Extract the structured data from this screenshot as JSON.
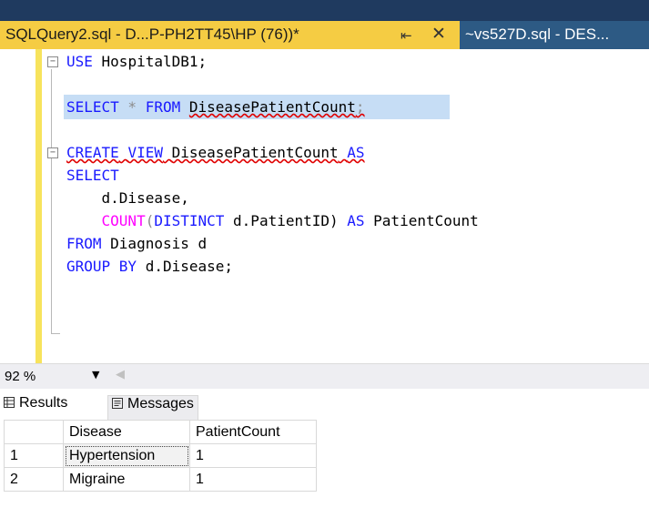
{
  "tabs": {
    "active": {
      "title": "SQLQuery2.sql - D...P-PH2TT45\\HP (76))*",
      "pin_icon": "pin-icon",
      "close_icon": "close-icon"
    },
    "inactive": {
      "title": "~vs527D.sql - DES..."
    }
  },
  "editor": {
    "line1": {
      "kw": "USE",
      "rest": " HospitalDB1;"
    },
    "line3": {
      "kw1": "SELECT",
      "star": " * ",
      "kw2": "FROM",
      "obj": "DiseasePatientCount",
      "semi": ";"
    },
    "line5": {
      "kw1": "CREATE",
      "kw2": "VIEW",
      "obj": "DiseasePatientCount",
      "kw3": "AS"
    },
    "line6": {
      "kw": "SELECT"
    },
    "line7": {
      "text": "    d.Disease,"
    },
    "line8": {
      "indent": "    ",
      "fn": "COUNT",
      "paren": "(",
      "kw": "DISTINCT",
      "col": " d.PatientID) ",
      "kw2": "AS",
      "alias": " PatientCount"
    },
    "line9": {
      "kw": "FROM",
      "rest": " Diagnosis d"
    },
    "line10": {
      "kw": "GROUP BY",
      "rest": " d.Disease;"
    }
  },
  "zoom": {
    "value": "92 %"
  },
  "results_tabs": {
    "results": "Results",
    "messages": "Messages"
  },
  "grid": {
    "columns": [
      "Disease",
      "PatientCount"
    ],
    "rows": [
      {
        "num": "1",
        "disease": "Hypertension",
        "count": "1"
      },
      {
        "num": "2",
        "disease": "Migraine",
        "count": "1"
      }
    ]
  },
  "colors": {
    "active_tab": "#f5cc43",
    "tab_strip": "#1f3a5f",
    "keyword": "#1a1aff",
    "function": "#ff00ff",
    "selection": "#c6ddf5"
  }
}
